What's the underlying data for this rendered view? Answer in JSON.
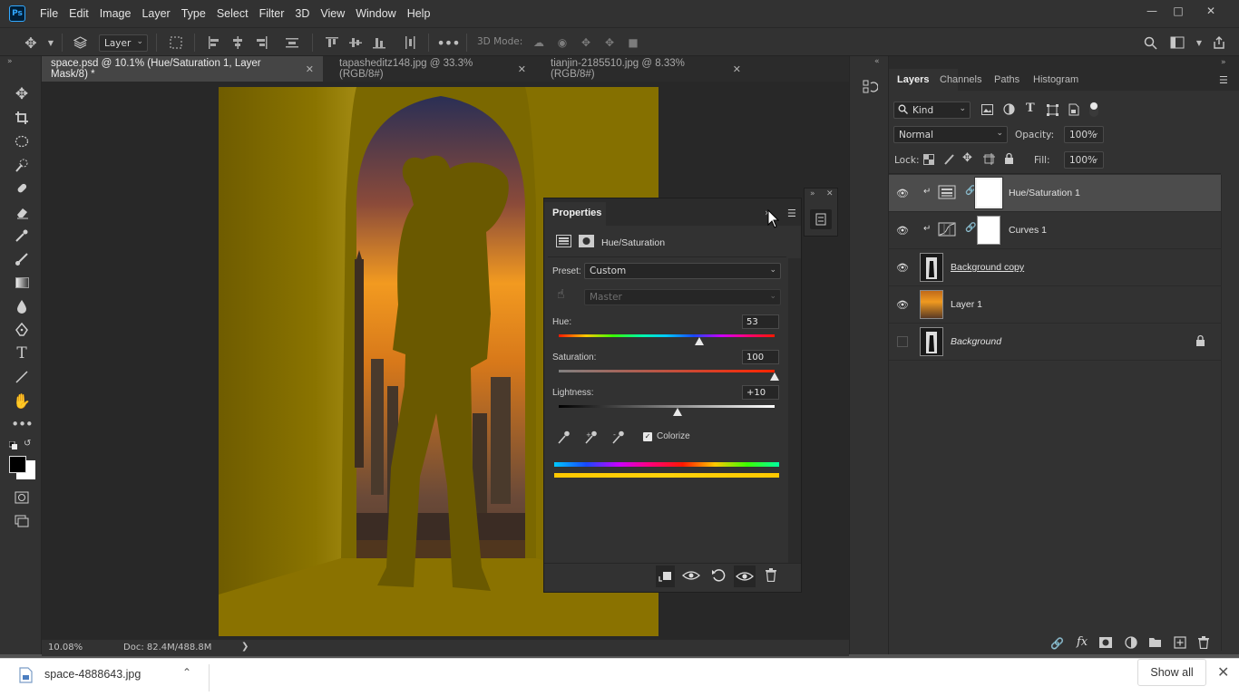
{
  "app": {
    "logo": "Ps"
  },
  "menu": [
    "File",
    "Edit",
    "Image",
    "Layer",
    "Type",
    "Select",
    "Filter",
    "3D",
    "View",
    "Window",
    "Help"
  ],
  "options_bar": {
    "layer_select": "Layer",
    "three_d_mode_label": "3D Mode:"
  },
  "doc_tabs": [
    {
      "title": "space.psd @ 10.1% (Hue/Saturation 1, Layer Mask/8) *",
      "active": true
    },
    {
      "title": "tapasheditz148.jpg @ 33.3% (RGB/8#)",
      "active": false
    },
    {
      "title": "tianjin-2185510.jpg @ 8.33% (RGB/8#)",
      "active": false
    }
  ],
  "status": {
    "zoom": "10.08%",
    "doc": "Doc: 82.4M/488.8M",
    "arrow": "❯"
  },
  "layers_panel": {
    "tabs": [
      "Layers",
      "Channels",
      "Paths",
      "Histogram"
    ],
    "filter": "Kind",
    "blend_mode": "Normal",
    "opacity_label": "Opacity:",
    "opacity": "100%",
    "lock_label": "Lock:",
    "fill_label": "Fill:",
    "fill": "100%",
    "layers": [
      {
        "name": "Hue/Saturation 1",
        "visible": true,
        "selected": true
      },
      {
        "name": "Curves 1",
        "visible": true,
        "selected": false
      },
      {
        "name": "Background copy",
        "visible": true,
        "selected": false
      },
      {
        "name": "Layer 1",
        "visible": true,
        "selected": false
      },
      {
        "name": "Background",
        "visible": false,
        "selected": false
      }
    ]
  },
  "properties": {
    "title": "Properties",
    "subtitle": "Hue/Saturation",
    "preset_label": "Preset:",
    "preset": "Custom",
    "channel": "Master",
    "hue_label": "Hue:",
    "hue": "53",
    "saturation_label": "Saturation:",
    "saturation": "100",
    "lightness_label": "Lightness:",
    "lightness": "+10",
    "colorize_label": "Colorize",
    "colorize_checked": true,
    "hue_level": 0.65,
    "saturation_level": 1.0,
    "lightness_level": 0.55
  },
  "download_bar": {
    "file": "space-4888643.jpg",
    "show_all": "Show all"
  },
  "colors": {
    "panel": "#323232",
    "accent": "#31a8ff",
    "tint": "#7d6a00"
  }
}
